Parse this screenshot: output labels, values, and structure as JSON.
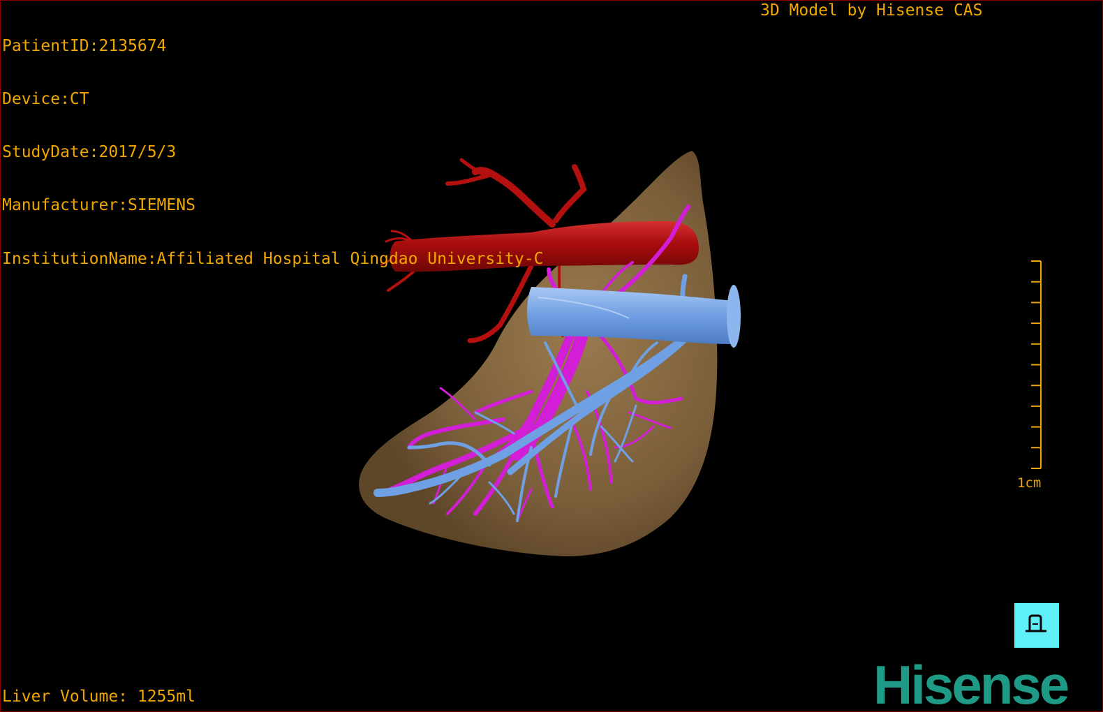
{
  "dicom_info": {
    "patient_id": "PatientID:2135674",
    "device": "Device:CT",
    "study_date": "StudyDate:2017/5/3",
    "manufacturer": "Manufacturer:SIEMENS",
    "institution": "InstitutionName:Affiliated Hospital Qingdao University-C"
  },
  "credit": "3D Model by Hisense CAS",
  "liver_volume": "Liver Volume: 1255ml",
  "scale_bar": {
    "label": "1cm",
    "tick_count": 10
  },
  "logo_text": "Hisense",
  "tool_icon": "cut-plane-icon",
  "colors": {
    "text": "#f0a800",
    "liver": "#8c6e45",
    "artery": "#c01010",
    "portal_vein": "#d21ed6",
    "hepatic_vein": "#6fa0e4",
    "logo": "#1f9a86",
    "tool_button": "#5ff0f7"
  }
}
